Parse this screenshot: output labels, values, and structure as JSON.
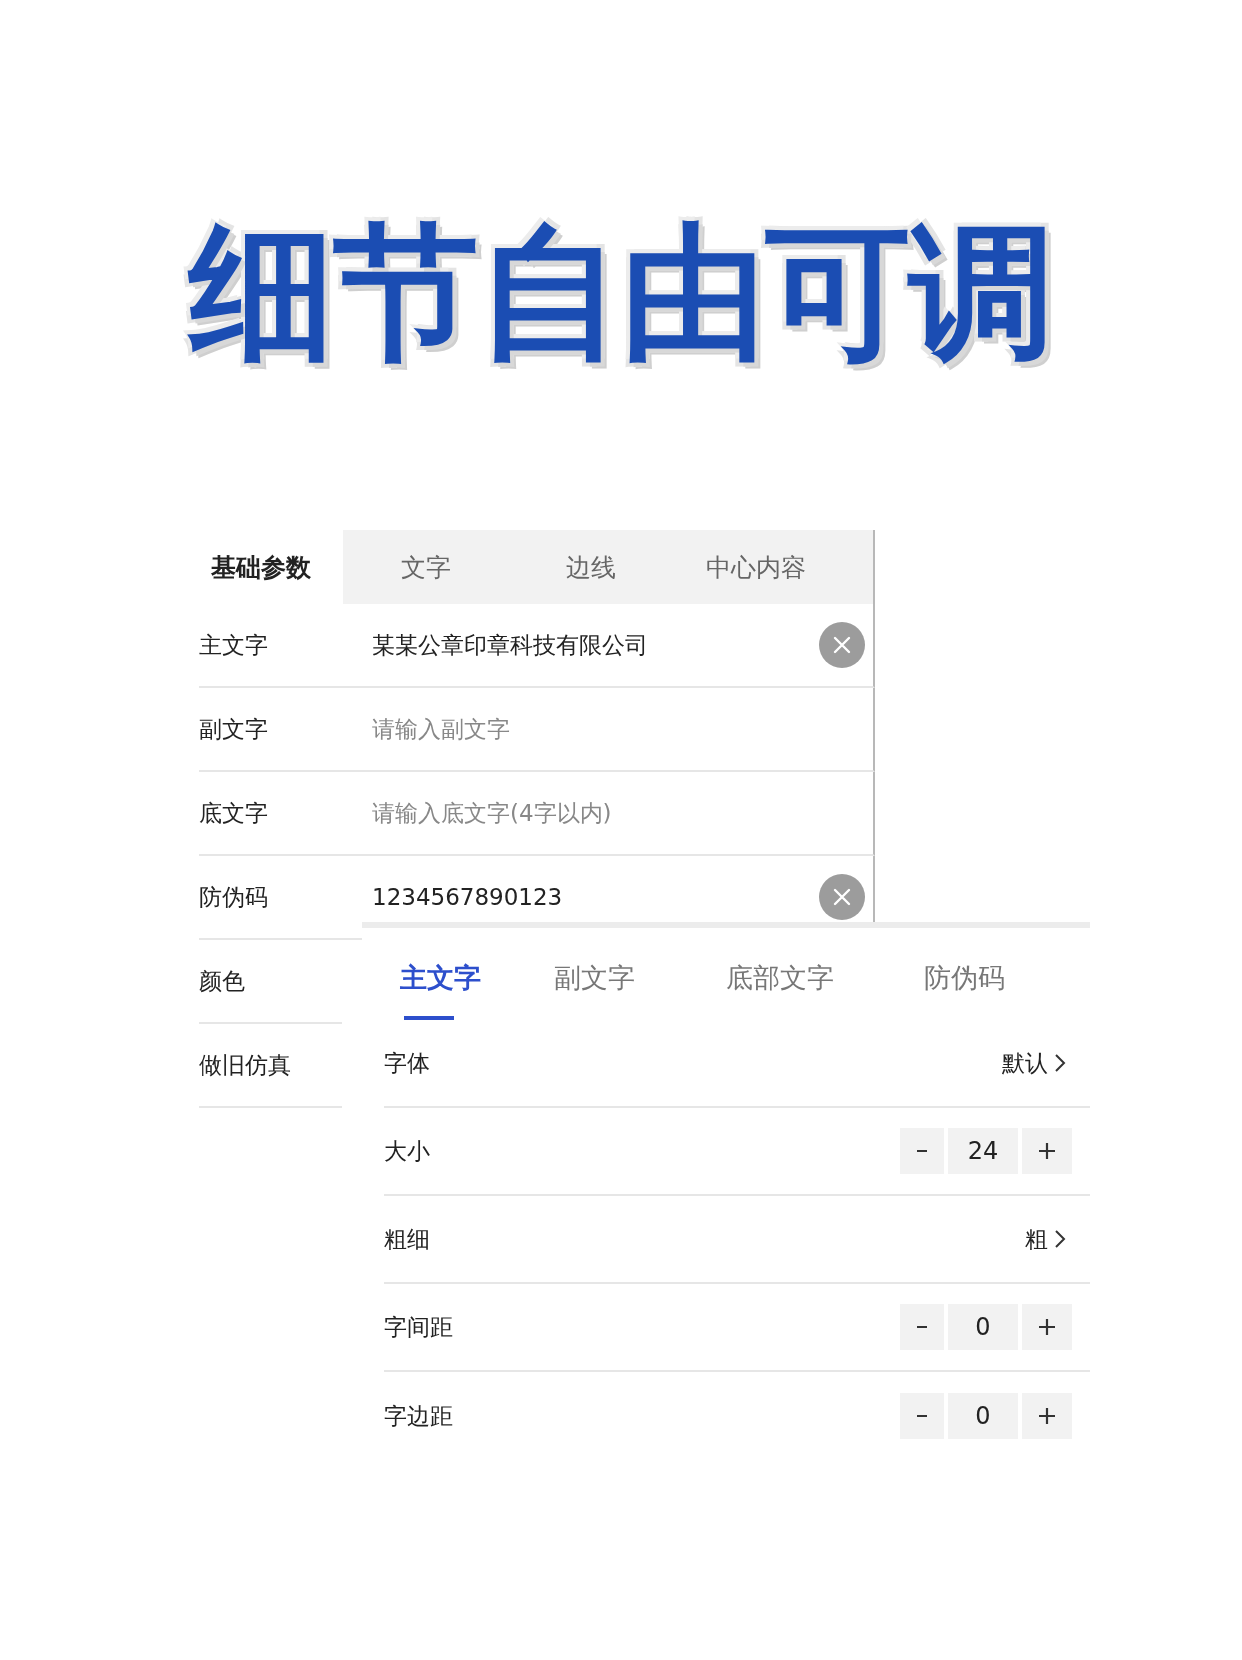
{
  "title": "细节自由可调",
  "basic_panel": {
    "tabs": [
      {
        "label": "基础参数",
        "selected": true
      },
      {
        "label": "文字",
        "selected": false
      },
      {
        "label": "边线",
        "selected": false
      },
      {
        "label": "中心内容",
        "selected": false
      }
    ],
    "fields": [
      {
        "label": "主文字",
        "value": "某某公章印章科技有限公司",
        "clearable": true
      },
      {
        "label": "副文字",
        "placeholder": "请输入副文字",
        "clearable": false
      },
      {
        "label": "底文字",
        "placeholder": "请输入底文字(4字以内)",
        "clearable": false
      },
      {
        "label": "防伪码",
        "value": "1234567890123",
        "clearable": true
      },
      {
        "label": "颜色"
      },
      {
        "label": "做旧仿真"
      }
    ]
  },
  "text_panel": {
    "tabs": [
      {
        "label": "主文字",
        "selected": true
      },
      {
        "label": "副文字",
        "selected": false
      },
      {
        "label": "底部文字",
        "selected": false
      },
      {
        "label": "防伪码",
        "selected": false
      }
    ],
    "rows": [
      {
        "kind": "select",
        "label": "字体",
        "value": "默认"
      },
      {
        "kind": "stepper",
        "label": "大小",
        "value": "24"
      },
      {
        "kind": "select",
        "label": "粗细",
        "value": "粗"
      },
      {
        "kind": "stepper",
        "label": "字间距",
        "value": "0"
      },
      {
        "kind": "stepper",
        "label": "字边距",
        "value": "0"
      }
    ]
  }
}
